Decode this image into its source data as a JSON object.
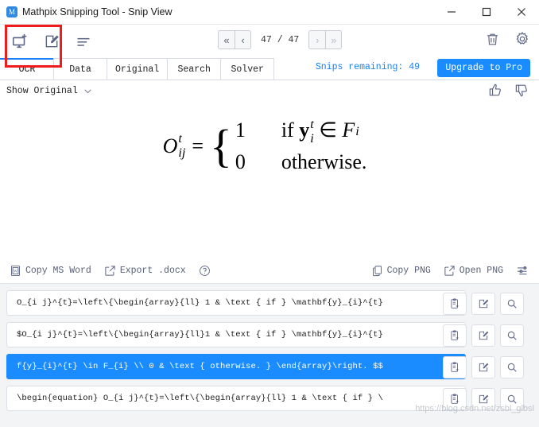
{
  "window": {
    "title": "Mathpix Snipping Tool - Snip View",
    "logo_letter": "M",
    "minimize_label": "Minimize",
    "maximize_label": "Maximize",
    "close_label": "Close"
  },
  "toolbar": {
    "icons": [
      {
        "name": "new-snip-icon",
        "label": "New Snip"
      },
      {
        "name": "edit-snip-icon",
        "label": "Edit Snip"
      },
      {
        "name": "list-view-icon",
        "label": "List View"
      }
    ],
    "nav": {
      "first_label": "«",
      "prev_label": "‹",
      "next_label": "›",
      "last_label": "»",
      "page_indicator": "47 / 47",
      "current_page": 47,
      "total_pages": 47
    },
    "right_icons": [
      {
        "name": "trash-icon",
        "label": "Delete"
      },
      {
        "name": "gear-icon",
        "label": "Settings"
      }
    ]
  },
  "tabs": {
    "items": [
      {
        "label": "OCR",
        "active": true
      },
      {
        "label": "Data",
        "active": false
      },
      {
        "label": "Original",
        "active": false
      },
      {
        "label": "Search",
        "active": false
      },
      {
        "label": "Solver",
        "active": false
      }
    ],
    "snips_remaining": "Snips remaining: 49",
    "upgrade_label": "Upgrade to Pro",
    "accent_color": "#1a8cff"
  },
  "show_original": {
    "label": "Show Original",
    "chevron": "chevron-down-icon"
  },
  "feedback": {
    "thumbs_up_label": "Good result",
    "thumbs_down_label": "Bad result"
  },
  "preview": {
    "equation_plain": "O_{ij}^{t} = { 1 if y_i^t ∈ F_i ; 0 otherwise.",
    "lhs_base": "O",
    "lhs_sup": "t",
    "lhs_sub": "ij",
    "equals": "=",
    "case_1_value": "1",
    "case_1_text_prefix": "if",
    "case_1_var": "y",
    "case_1_var_sup": "t",
    "case_1_var_sub": "i",
    "case_1_in": "∈",
    "case_1_set": "F",
    "case_1_set_sub": "i",
    "case_2_value": "0",
    "case_2_text": "otherwise."
  },
  "action_bar": {
    "left": [
      {
        "name": "copy-ms-word-button",
        "icon": "word-doc-icon",
        "label": "Copy MS Word"
      },
      {
        "name": "export-docx-button",
        "icon": "external-link-icon",
        "label": "Export .docx"
      },
      {
        "name": "help-button",
        "icon": "question-circle-icon",
        "label": ""
      }
    ],
    "right": [
      {
        "name": "copy-png-button",
        "icon": "copy-icon",
        "label": "Copy PNG"
      },
      {
        "name": "open-png-button",
        "icon": "external-link-icon",
        "label": "Open PNG"
      },
      {
        "name": "png-settings-button",
        "icon": "sliders-icon",
        "label": ""
      }
    ]
  },
  "results": {
    "row_button_labels": {
      "copy": "Copy to clipboard",
      "edit": "Edit",
      "search": "Search"
    },
    "rows": [
      {
        "text": "O_{i j}^{t}=\\left\\{\\begin{array}{ll} 1 & \\text { if } \\mathbf{y}_{i}^{t}",
        "selected": false
      },
      {
        "text": "$O_{i j}^{t}=\\left\\{\\begin{array}{ll}1 & \\text { if } \\mathbf{y}_{i}^{t}",
        "selected": false
      },
      {
        "text": "f{y}_{i}^{t} \\in F_{i} \\\\ 0 & \\text { otherwise. } \\end{array}\\right.  $$",
        "selected": true
      },
      {
        "text": "\\begin{equation}  O_{i j}^{t}=\\left\\{\\begin{array}{ll} 1 & \\text { if } \\",
        "selected": false
      }
    ]
  },
  "annotation": {
    "rect_color": "#ee1c1c"
  },
  "watermark": {
    "text": "https://blog.csdn.net/zsbl_glbsl"
  }
}
